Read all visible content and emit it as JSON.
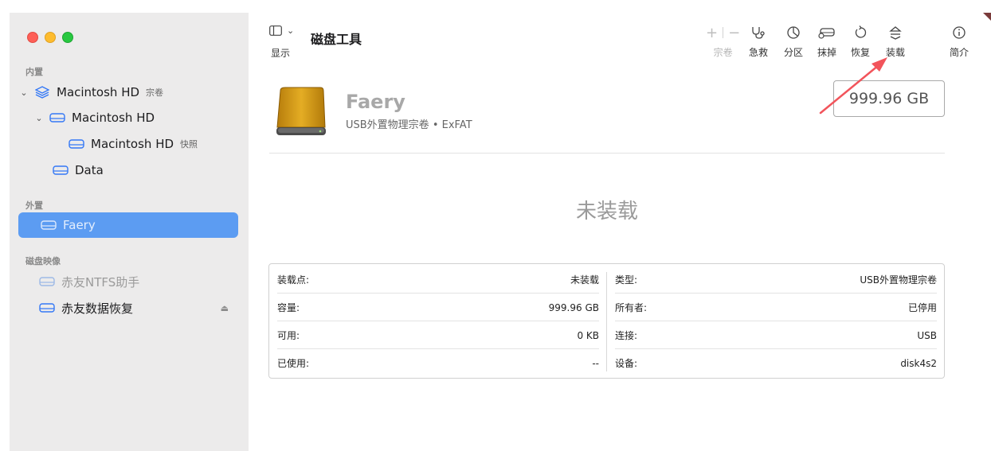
{
  "window": {
    "accent": "#5c9cf2"
  },
  "sidebar": {
    "sections": {
      "internal": "内置",
      "external": "外置",
      "images": "磁盘映像"
    },
    "items": [
      {
        "label": "Macintosh HD",
        "sub": "宗卷",
        "icon": "layers-icon"
      },
      {
        "label": "Macintosh HD",
        "sub": "",
        "icon": "drive-icon"
      },
      {
        "label": "Macintosh HD",
        "sub": "快照",
        "icon": "drive-icon"
      },
      {
        "label": "Data",
        "sub": "",
        "icon": "drive-icon"
      },
      {
        "label": "Faery",
        "sub": "",
        "icon": "drive-icon",
        "selected": true
      },
      {
        "label": "赤友NTFS助手",
        "sub": "",
        "icon": "drive-icon",
        "dimmed": true
      },
      {
        "label": "赤友数据恢复",
        "sub": "",
        "icon": "drive-icon",
        "eject": "⏏"
      }
    ]
  },
  "toolbar": {
    "sidebar_label": "显示",
    "title": "磁盘工具",
    "volume_label": "宗卷",
    "first_aid_label": "急救",
    "partition_label": "分区",
    "erase_label": "抹掉",
    "restore_label": "恢复",
    "mount_label": "装载",
    "info_label": "简介"
  },
  "disk": {
    "name": "Faery",
    "description": "USB外置物理宗卷 • ExFAT",
    "capacity": "999.96 GB",
    "status": "未装载",
    "icon_color": "#d9a21a"
  },
  "info": {
    "left": [
      {
        "label": "装载点:",
        "value": "未装载"
      },
      {
        "label": "容量:",
        "value": "999.96 GB"
      },
      {
        "label": "可用:",
        "value": "0 KB"
      },
      {
        "label": "已使用:",
        "value": "--"
      }
    ],
    "right": [
      {
        "label": "类型:",
        "value": "USB外置物理宗卷"
      },
      {
        "label": "所有者:",
        "value": "已停用"
      },
      {
        "label": "连接:",
        "value": "USB"
      },
      {
        "label": "设备:",
        "value": "disk4s2"
      }
    ]
  },
  "annotation": {
    "color": "#f2545b"
  }
}
